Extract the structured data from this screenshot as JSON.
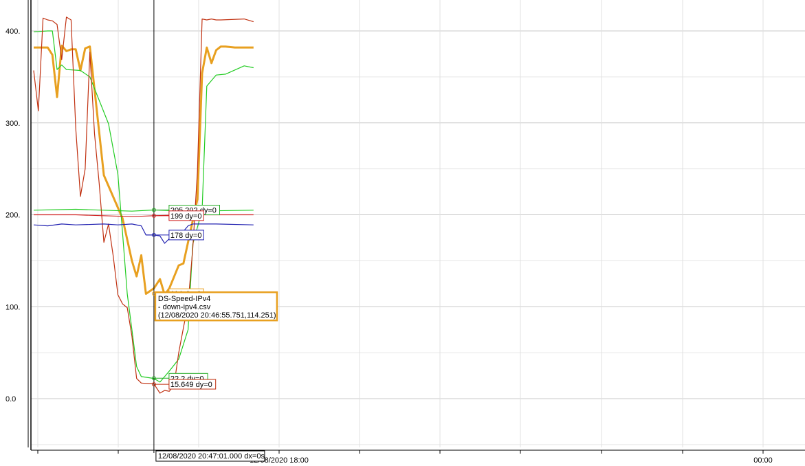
{
  "chart_data": {
    "type": "line",
    "title": "",
    "xlabel": "",
    "ylabel": "",
    "ylim": [
      -50,
      420
    ],
    "grid": true,
    "y_ticks": [
      "0.0",
      "100.",
      "200.",
      "300.",
      "400."
    ],
    "x_ticks": [
      "12/08/2020 18:00",
      "00:00"
    ],
    "series": [
      {
        "color": "#e8a020",
        "x": [
          "12/08/2020 16:30",
          "12/08/2020 17:00",
          "12/08/2020 17:10",
          "12/08/2020 17:20",
          "12/08/2020 17:30",
          "12/08/2020 17:40",
          "12/08/2020 17:50",
          "12/08/2020 18:00",
          "12/08/2020 18:10",
          "12/08/2020 18:20",
          "12/08/2020 18:30",
          "12/08/2020 19:00",
          "12/08/2020 19:40",
          "12/08/2020 20:00",
          "12/08/2020 20:10",
          "12/08/2020 20:20",
          "12/08/2020 20:30",
          "12/08/2020 20:47",
          "12/08/2020 21:00",
          "12/08/2020 21:10",
          "12/08/2020 21:20",
          "12/08/2020 21:40",
          "12/08/2020 21:50",
          "12/08/2020 22:20",
          "12/08/2020 22:30",
          "12/08/2020 22:40",
          "12/08/2020 22:50",
          "12/08/2020 23:00",
          "12/08/2020 23:10",
          "12/08/2020 23:20",
          "12/08/2020 23:40",
          "12/08/2020 23:50",
          "12/09/2020 00:00",
          "12/09/2020 00:20"
        ],
        "values": [
          382,
          382,
          374,
          328,
          384,
          378,
          380,
          380,
          357,
          381,
          383,
          243,
          196,
          150,
          133,
          156,
          114,
          120,
          130,
          113,
          120,
          145,
          147,
          217,
          354,
          382,
          365,
          379,
          383,
          383,
          382,
          382,
          382,
          382
        ]
      },
      {
        "color": "#22cc22",
        "x": [
          "12/08/2020 16:30",
          "12/08/2020 17:00",
          "12/08/2020 17:10",
          "12/08/2020 17:20",
          "12/08/2020 17:30",
          "12/08/2020 17:40",
          "12/08/2020 18:10",
          "12/08/2020 18:30",
          "12/08/2020 19:10",
          "12/08/2020 19:30",
          "12/08/2020 19:40",
          "12/08/2020 19:50",
          "12/08/2020 20:00",
          "12/08/2020 20:10",
          "12/08/2020 20:20",
          "12/08/2020 20:47",
          "12/08/2020 21:00",
          "12/08/2020 21:20",
          "12/08/2020 21:40",
          "12/08/2020 22:00",
          "12/08/2020 22:10",
          "12/08/2020 22:30",
          "12/08/2020 22:40",
          "12/08/2020 23:00",
          "12/08/2020 23:20",
          "12/09/2020 00:00",
          "12/09/2020 00:20"
        ],
        "values": [
          399,
          400,
          400,
          358,
          363,
          358,
          357,
          350,
          299,
          244,
          180,
          114,
          75,
          35,
          24,
          22,
          18,
          30,
          43,
          75,
          168,
          205,
          340,
          352,
          353,
          362,
          360
        ]
      },
      {
        "color": "#c03010",
        "x": [
          "12/08/2020 16:30",
          "12/08/2020 16:40",
          "12/08/2020 16:50",
          "12/08/2020 17:00",
          "12/08/2020 17:10",
          "12/08/2020 17:20",
          "12/08/2020 17:30",
          "12/08/2020 17:40",
          "12/08/2020 17:50",
          "12/08/2020 18:00",
          "12/08/2020 18:10",
          "12/08/2020 18:20",
          "12/08/2020 18:30",
          "12/08/2020 18:40",
          "12/08/2020 18:50",
          "12/08/2020 19:00",
          "12/08/2020 19:10",
          "12/08/2020 19:20",
          "12/08/2020 19:30",
          "12/08/2020 19:40",
          "12/08/2020 19:50",
          "12/08/2020 20:00",
          "12/08/2020 20:10",
          "12/08/2020 20:20",
          "12/08/2020 20:47",
          "12/08/2020 21:00",
          "12/08/2020 21:10",
          "12/08/2020 21:20",
          "12/08/2020 21:30",
          "12/08/2020 21:40",
          "12/08/2020 21:50",
          "12/08/2020 22:00",
          "12/08/2020 22:10",
          "12/08/2020 22:20",
          "12/08/2020 22:30",
          "12/08/2020 22:40",
          "12/08/2020 22:50",
          "12/08/2020 23:00",
          "12/08/2020 23:10",
          "12/09/2020 00:00",
          "12/09/2020 00:20"
        ],
        "values": [
          357,
          313,
          414,
          412,
          411,
          407,
          369,
          415,
          412,
          294,
          220,
          250,
          377,
          288,
          234,
          170,
          190,
          155,
          113,
          103,
          99,
          68,
          22,
          17,
          16,
          6,
          9,
          8,
          15,
          50,
          77,
          103,
          163,
          247,
          413,
          412,
          413,
          412,
          412,
          413,
          410
        ]
      },
      {
        "color": "#22cc22",
        "x": [
          "12/08/2020 16:30",
          "12/08/2020 18:00",
          "12/08/2020 20:00",
          "12/08/2020 20:47",
          "12/08/2020 22:00",
          "12/09/2020 00:20"
        ],
        "values": [
          205,
          206,
          204,
          205.202,
          204,
          205
        ]
      },
      {
        "color": "#d02020",
        "x": [
          "12/08/2020 16:30",
          "12/08/2020 18:00",
          "12/08/2020 20:00",
          "12/08/2020 20:47",
          "12/08/2020 22:00",
          "12/09/2020 00:20"
        ],
        "values": [
          200,
          200,
          198,
          199,
          200,
          200
        ]
      },
      {
        "color": "#2020b0",
        "x": [
          "12/08/2020 16:30",
          "12/08/2020 17:00",
          "12/08/2020 17:30",
          "12/08/2020 18:00",
          "12/08/2020 19:00",
          "12/08/2020 19:30",
          "12/08/2020 20:00",
          "12/08/2020 20:20",
          "12/08/2020 20:30",
          "12/08/2020 20:47",
          "12/08/2020 21:00",
          "12/08/2020 21:10",
          "12/08/2020 21:20",
          "12/08/2020 21:30",
          "12/08/2020 21:40",
          "12/08/2020 21:50",
          "12/08/2020 22:00",
          "12/08/2020 22:10",
          "12/08/2020 23:00",
          "12/09/2020 00:20"
        ],
        "values": [
          189,
          188,
          190,
          189,
          190,
          189,
          190,
          188,
          178,
          178,
          177,
          169,
          174,
          180,
          183,
          182,
          188,
          190,
          190,
          189
        ]
      }
    ],
    "cursor": {
      "x": "12/08/2020 20:47:01.000",
      "label": "12/08/2020 20:47:01.000 dx=0s"
    },
    "annotations": [
      {
        "text": "205.202 dy=0",
        "color": "#22aa22",
        "y": 205.202
      },
      {
        "text": "199 dy=0",
        "color": "#d02020",
        "y": 199
      },
      {
        "text": "178 dy=0",
        "color": "#2020b0",
        "y": 178
      },
      {
        "text": "114 dy=0",
        "color": "#e8a020",
        "y": 114.251
      },
      {
        "text": "22.2 dy=0",
        "color": "#22aa22",
        "y": 22.2
      },
      {
        "text": "15.649 dy=0",
        "color": "#c03010",
        "y": 15.649
      }
    ],
    "tooltip": {
      "lines": [
        "DS-Speed-IPv4",
        "- down-ipv4.csv",
        "(12/08/2020 20:46:55.751,114.251)"
      ],
      "color": "#e8a020"
    }
  }
}
